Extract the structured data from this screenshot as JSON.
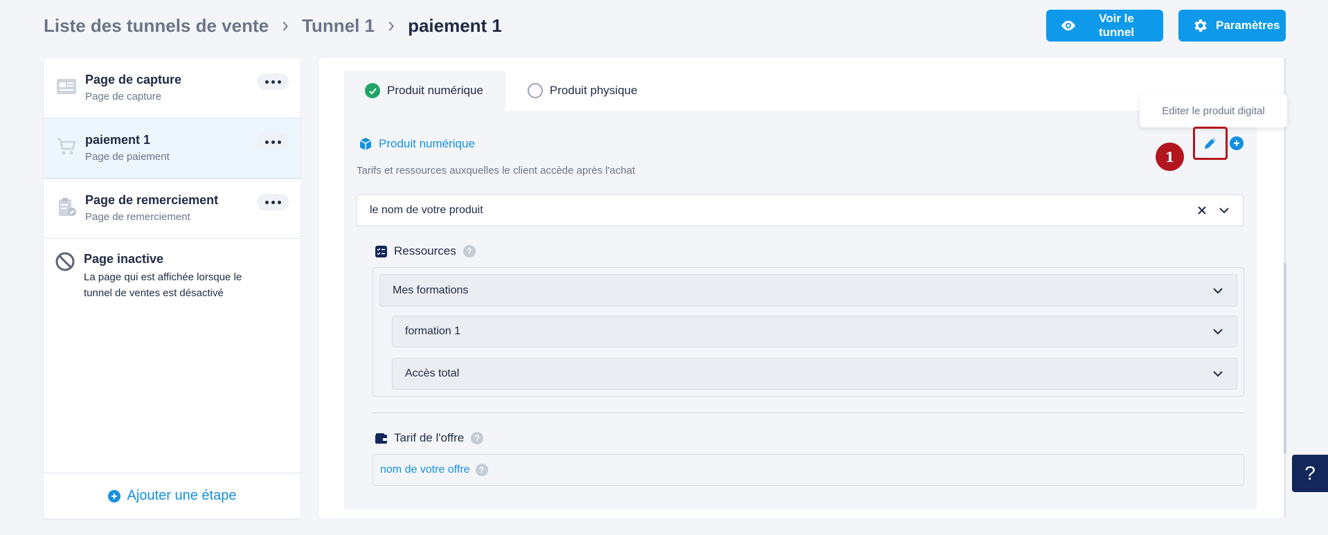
{
  "breadcrumb": {
    "items": [
      "Liste des tunnels de vente",
      "Tunnel 1"
    ],
    "current": "paiement 1"
  },
  "header": {
    "view_button": "Voir le tunnel",
    "settings_button": "Paramètres"
  },
  "sidebar": {
    "steps": [
      {
        "title": "Page de capture",
        "subtitle": "Page de capture",
        "icon": "capture-page-icon"
      },
      {
        "title": "paiement 1",
        "subtitle": "Page de paiement",
        "icon": "cart-icon",
        "active": true
      },
      {
        "title": "Page de remerciement",
        "subtitle": "Page de remerciement",
        "icon": "clipboard-check-icon"
      }
    ],
    "inactive": {
      "title": "Page inactive",
      "description": "La page qui est affichée lorsque le tunnel de ventes est désactivé"
    },
    "add_step": "Ajouter une étape"
  },
  "tabs": [
    {
      "label": "Produit numérique",
      "selected": true
    },
    {
      "label": "Produit physique",
      "selected": false
    }
  ],
  "product": {
    "heading": "Produit numérique",
    "description": "Tarifs et ressources auxquelles le client accède après l'achat",
    "selected_value": "le nom de votre produit",
    "tooltip": "Editer le produit digital",
    "marker": "1"
  },
  "resources": {
    "label": "Ressources",
    "group_value": "Mes formations",
    "formation_value": "formation 1",
    "access_value": "Accès total"
  },
  "offer": {
    "label": "Tarif de l'offre",
    "value": "nom de votre offre"
  },
  "help_button": "?",
  "colors": {
    "accent": "#0f99ea",
    "link": "#1590e0",
    "success": "#22a466",
    "marker": "#b3151e",
    "navy": "#14275a"
  }
}
